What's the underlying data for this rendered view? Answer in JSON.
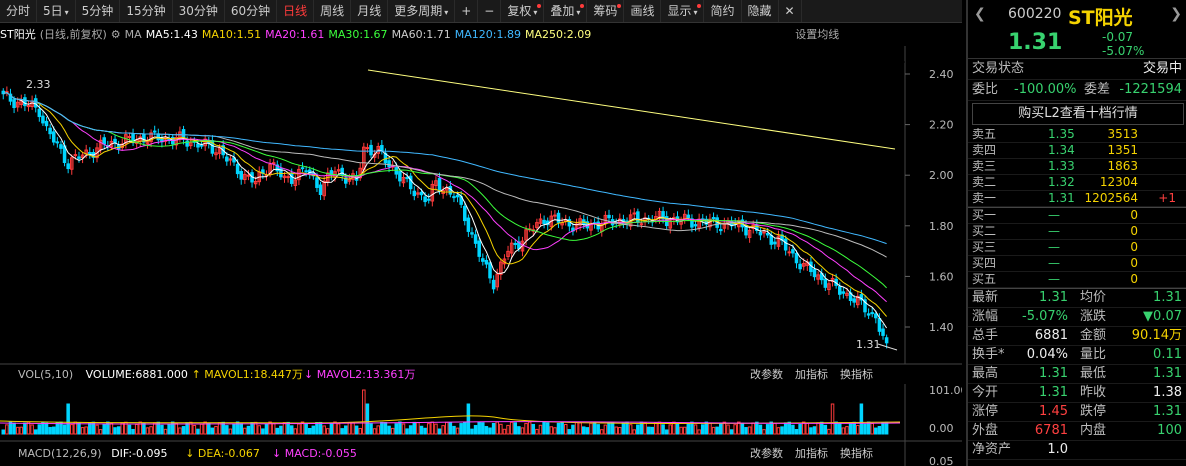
{
  "toolbar": {
    "items": [
      "分时",
      "5日",
      "5分钟",
      "15分钟",
      "30分钟",
      "60分钟",
      "日线",
      "周线",
      "月线",
      "更多周期",
      "+",
      "−",
      "复权",
      "叠加",
      "筹码",
      "画线",
      "显示",
      "简约",
      "隐藏"
    ],
    "active_index": 6,
    "close": "✕"
  },
  "legend": {
    "name": "ST阳光",
    "mode": "(日线,前复权)",
    "ma": "MA",
    "ma5": "MA5:1.43",
    "ma10": "MA10:1.51",
    "ma20": "MA20:1.61",
    "ma30": "MA30:1.67",
    "ma60": "MA60:1.71",
    "ma120": "MA120:1.89",
    "ma250": "MA250:2.09",
    "settings": "设置均线"
  },
  "price_axis": [
    "2.40",
    "2.20",
    "2.00",
    "1.80",
    "1.60",
    "1.40"
  ],
  "price_labels": {
    "high": "2.33",
    "last": "1.31"
  },
  "vol_legend": {
    "title": "VOL(5,10)",
    "volume": "VOLUME:6881.000",
    "mavol1": "MAVOL1:18.447万",
    "mavol2": "MAVOL2:13.361万",
    "actions": [
      "改参数",
      "加指标",
      "换指标"
    ]
  },
  "vol_axis": [
    "101.00",
    "0.00"
  ],
  "macd_legend": {
    "title": "MACD(12,26,9)",
    "dif": "DIF:-0.095",
    "dea": "DEA:-0.067",
    "macd": "MACD:-0.055",
    "actions": [
      "改参数",
      "加指标",
      "换指标"
    ],
    "axis": "0.05"
  },
  "colors": {
    "up": "#ff3b3b",
    "down": "#00d5ff",
    "ma5": "#ffffff",
    "ma10": "#f5d300",
    "ma20": "#ff40ff",
    "ma30": "#3cff3c",
    "ma60": "#bbbbbb",
    "ma120": "#40b8ff",
    "ma250": "#ffff80"
  },
  "panel": {
    "code": "600220",
    "name": "ST阳光",
    "price": "1.31",
    "change": "-0.07",
    "pct": "-5.07%",
    "status_label": "交易状态",
    "status_value": "交易中",
    "weibi_label": "委比",
    "weibi": "-100.00%",
    "weicha_label": "委差",
    "weicha": "-1221594",
    "l2": "购买L2查看十档行情",
    "asks": [
      {
        "label": "卖五",
        "price": "1.35",
        "vol": "3513",
        "extra": ""
      },
      {
        "label": "卖四",
        "price": "1.34",
        "vol": "1351",
        "extra": ""
      },
      {
        "label": "卖三",
        "price": "1.33",
        "vol": "1863",
        "extra": ""
      },
      {
        "label": "卖二",
        "price": "1.32",
        "vol": "12304",
        "extra": ""
      },
      {
        "label": "卖一",
        "price": "1.31",
        "vol": "1202564",
        "extra": "+1"
      }
    ],
    "bids": [
      {
        "label": "买一",
        "price": "—",
        "vol": "0"
      },
      {
        "label": "买二",
        "price": "—",
        "vol": "0"
      },
      {
        "label": "买三",
        "price": "—",
        "vol": "0"
      },
      {
        "label": "买四",
        "price": "—",
        "vol": "0"
      },
      {
        "label": "买五",
        "price": "—",
        "vol": "0"
      }
    ],
    "stats": [
      {
        "l1": "最新",
        "v1": "1.31",
        "l2": "均价",
        "v2": "1.31"
      },
      {
        "l1": "涨幅",
        "v1": "-5.07%",
        "l2": "涨跌",
        "v2": "▼0.07"
      },
      {
        "l1": "总手",
        "v1": "6881",
        "l2": "金额",
        "v2": "90.14万"
      },
      {
        "l1": "换手*",
        "v1": "0.04%",
        "l2": "量比",
        "v2": "0.11"
      },
      {
        "l1": "最高",
        "v1": "1.31",
        "l2": "最低",
        "v2": "1.31"
      },
      {
        "l1": "今开",
        "v1": "1.31",
        "l2": "昨收",
        "v2": "1.38"
      },
      {
        "l1": "涨停",
        "v1": "1.45",
        "l2": "跌停",
        "v2": "1.31"
      },
      {
        "l1": "外盘",
        "v1": "6781",
        "l2": "内盘",
        "v2": "100"
      },
      {
        "l1": "净资产",
        "v1": "1.0",
        "l2": "",
        "v2": ""
      }
    ]
  }
}
